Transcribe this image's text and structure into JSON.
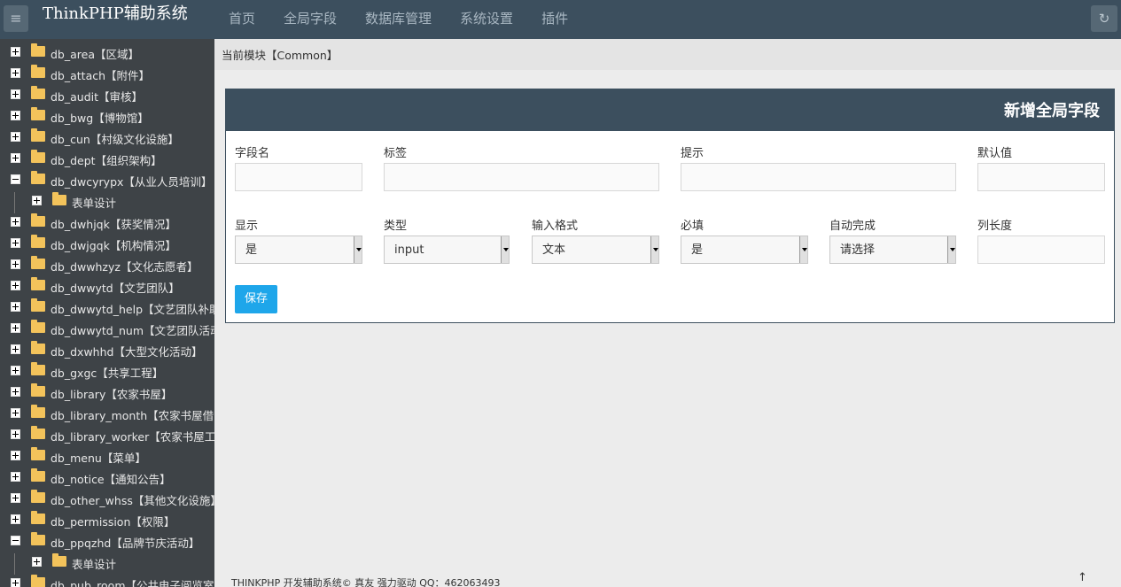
{
  "app": {
    "title": "ThinkPHP辅助系统"
  },
  "navbar": {
    "items": [
      "首页",
      "全局字段",
      "数据库管理",
      "系统设置",
      "插件"
    ],
    "menu_icon": "menu-icon",
    "refresh_icon": "refresh-icon"
  },
  "sidebar": {
    "items": [
      {
        "label": "db_area【区域】",
        "expanded": false,
        "level": 0
      },
      {
        "label": "db_attach【附件】",
        "expanded": false,
        "level": 0
      },
      {
        "label": "db_audit【审核】",
        "expanded": false,
        "level": 0
      },
      {
        "label": "db_bwg【博物馆】",
        "expanded": false,
        "level": 0
      },
      {
        "label": "db_cun【村级文化设施】",
        "expanded": false,
        "level": 0
      },
      {
        "label": "db_dept【组织架构】",
        "expanded": false,
        "level": 0
      },
      {
        "label": "db_dwcyrypx【从业人员培训】",
        "expanded": true,
        "level": 0
      },
      {
        "label": "表单设计",
        "expanded": false,
        "level": 1
      },
      {
        "label": "db_dwhjqk【获奖情况】",
        "expanded": false,
        "level": 0
      },
      {
        "label": "db_dwjgqk【机构情况】",
        "expanded": false,
        "level": 0
      },
      {
        "label": "db_dwwhzyz【文化志愿者】",
        "expanded": false,
        "level": 0
      },
      {
        "label": "db_dwwytd【文艺团队】",
        "expanded": false,
        "level": 0
      },
      {
        "label": "db_dwwytd_help【文艺团队补助",
        "expanded": false,
        "level": 0
      },
      {
        "label": "db_dwwytd_num【文艺团队活动",
        "expanded": false,
        "level": 0
      },
      {
        "label": "db_dxwhhd【大型文化活动】",
        "expanded": false,
        "level": 0
      },
      {
        "label": "db_gxgc【共享工程】",
        "expanded": false,
        "level": 0
      },
      {
        "label": "db_library【农家书屋】",
        "expanded": false,
        "level": 0
      },
      {
        "label": "db_library_month【农家书屋借阅",
        "expanded": false,
        "level": 0
      },
      {
        "label": "db_library_worker【农家书屋工作",
        "expanded": false,
        "level": 0
      },
      {
        "label": "db_menu【菜单】",
        "expanded": false,
        "level": 0
      },
      {
        "label": "db_notice【通知公告】",
        "expanded": false,
        "level": 0
      },
      {
        "label": "db_other_whss【其他文化设施】",
        "expanded": false,
        "level": 0
      },
      {
        "label": "db_permission【权限】",
        "expanded": false,
        "level": 0
      },
      {
        "label": "db_ppqzhd【品牌节庆活动】",
        "expanded": true,
        "level": 0
      },
      {
        "label": "表单设计",
        "expanded": false,
        "level": 1
      },
      {
        "label": "db_pub_room【公共电子阅览室",
        "expanded": false,
        "level": 0
      }
    ]
  },
  "breadcrumb": {
    "text": "当前模块【Common】"
  },
  "form": {
    "title": "新增全局字段",
    "fields": {
      "name": {
        "label": "字段名",
        "value": ""
      },
      "tag": {
        "label": "标签",
        "value": ""
      },
      "hint": {
        "label": "提示",
        "value": ""
      },
      "default": {
        "label": "默认值",
        "value": ""
      },
      "display": {
        "label": "显示",
        "value": "是"
      },
      "type": {
        "label": "类型",
        "value": "input"
      },
      "input_format": {
        "label": "输入格式",
        "value": "文本"
      },
      "required": {
        "label": "必填",
        "value": "是"
      },
      "autocomplete": {
        "label": "自动完成",
        "value": "请选择"
      },
      "column_length": {
        "label": "列长度",
        "value": ""
      }
    },
    "save_label": "保存"
  },
  "footer": {
    "text": "THINKPHP 开发辅助系统© 真友 强力驱动 QQ：462063493",
    "scroll_top_icon": "↑"
  },
  "colors": {
    "navbar": "#3c4f5e",
    "sidebar": "#3e4347",
    "primary_button": "#1ea6ea",
    "folder": "#f3c35b"
  }
}
